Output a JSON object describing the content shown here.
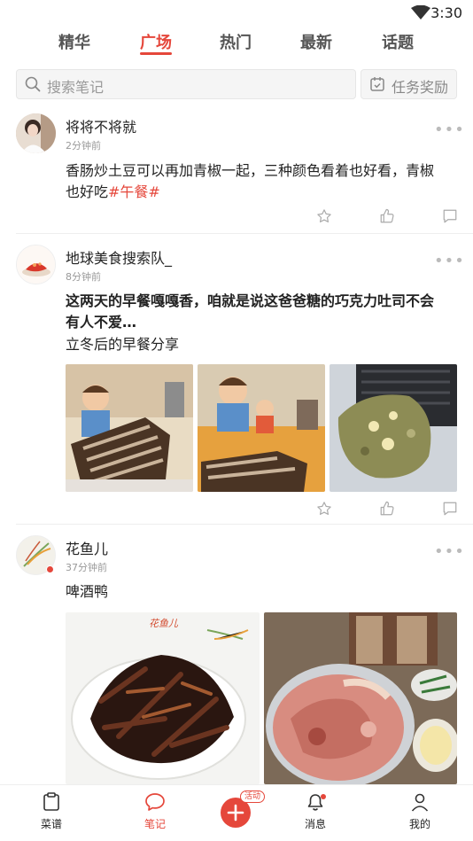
{
  "status_bar": {
    "time": "3:30",
    "wifi_icon": "wifi-icon"
  },
  "tabs": [
    {
      "label": "精华",
      "active": false
    },
    {
      "label": "广场",
      "active": true
    },
    {
      "label": "热门",
      "active": false
    },
    {
      "label": "最新",
      "active": false
    },
    {
      "label": "话题",
      "active": false
    }
  ],
  "search": {
    "placeholder": "搜索笔记",
    "icon": "search-icon"
  },
  "reward_button": {
    "label": "任务奖励",
    "icon": "calendar-icon"
  },
  "posts": [
    {
      "username": "将将不将就",
      "time": "2分钟前",
      "text": "香肠炒土豆可以再加青椒一起，三种颜色看着也好看，青椒也好吃",
      "tag": "#午餐#"
    },
    {
      "username": "地球美食搜索队_",
      "time": "8分钟前",
      "title": "这两天的早餐嘎嘎香，咱就是说这爸爸糖的巧克力吐司不会有人不爱…",
      "text": "立冬后的早餐分享"
    },
    {
      "username": "花鱼儿",
      "time": "37分钟前",
      "text": "啤酒鸭",
      "watermark": "花鱼儿"
    }
  ],
  "more_label": "•••",
  "bottom_nav": [
    {
      "label": "菜谱",
      "icon": "clipboard-icon",
      "active": false
    },
    {
      "label": "笔记",
      "icon": "chat-bubble-icon",
      "active": true
    },
    {
      "label": "消息",
      "icon": "bell-icon",
      "active": false
    },
    {
      "label": "我的",
      "icon": "person-icon",
      "active": false
    }
  ],
  "fab_badge": "活动",
  "colors": {
    "accent": "#e5473b",
    "text": "#222222",
    "muted": "#999999"
  }
}
